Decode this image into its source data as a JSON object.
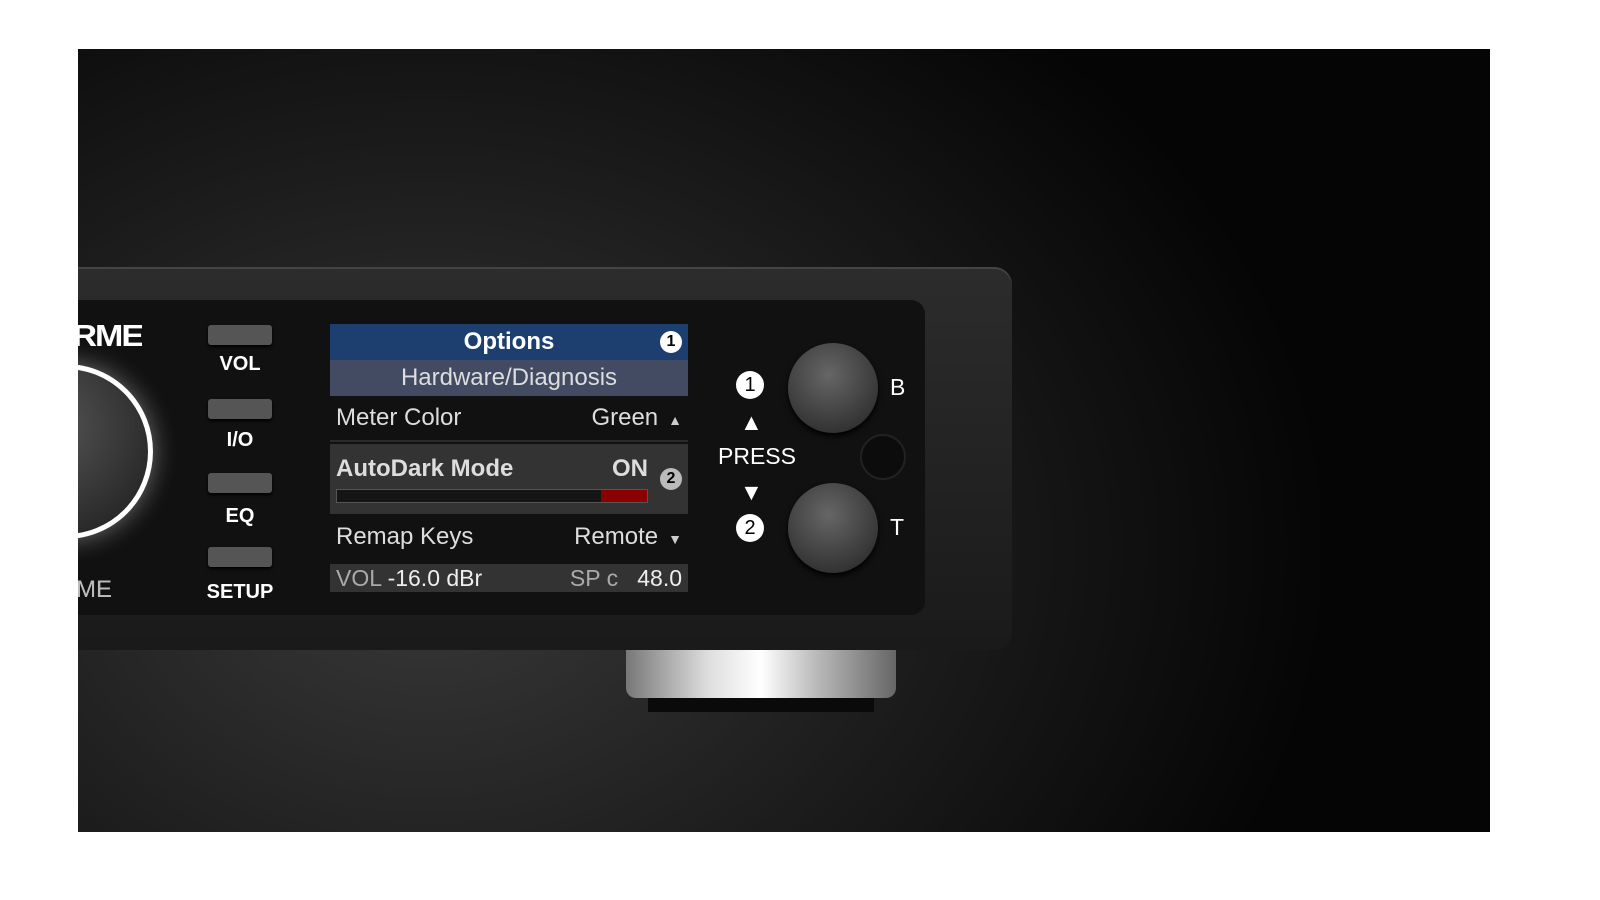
{
  "device": {
    "logo_text": "RME",
    "volume_label": "VOLUME",
    "visible_volume_fragment": "ME"
  },
  "buttons": [
    {
      "label": "VOL"
    },
    {
      "label": "I/O"
    },
    {
      "label": "EQ"
    },
    {
      "label": "SETUP"
    }
  ],
  "display": {
    "title": "Options",
    "title_badge": "1",
    "subtitle": "Hardware/Diagnosis",
    "items": [
      {
        "label": "Meter Color",
        "value": "Green",
        "arrow": "up"
      },
      {
        "label": "AutoDark Mode",
        "value": "ON",
        "badge": "2",
        "selected": true,
        "meter_level_percent": 15,
        "meter_color": "#8b0000"
      },
      {
        "label": "Remap Keys",
        "value": "Remote",
        "arrow": "down"
      }
    ],
    "status": {
      "vol_label": "VOL",
      "vol_value": "-16.0 dBr",
      "sp_label": "SP c",
      "sp_value": "48.0"
    },
    "colors": {
      "title_bg": "#1d3f70",
      "subtitle_bg": "#434b63"
    }
  },
  "controls": {
    "badge1": "1",
    "badge2": "2",
    "up_arrow": "▲",
    "down_arrow": "▼",
    "press_label": "PRESS",
    "knob_top_label": "B",
    "knob_bottom_label": "T"
  }
}
